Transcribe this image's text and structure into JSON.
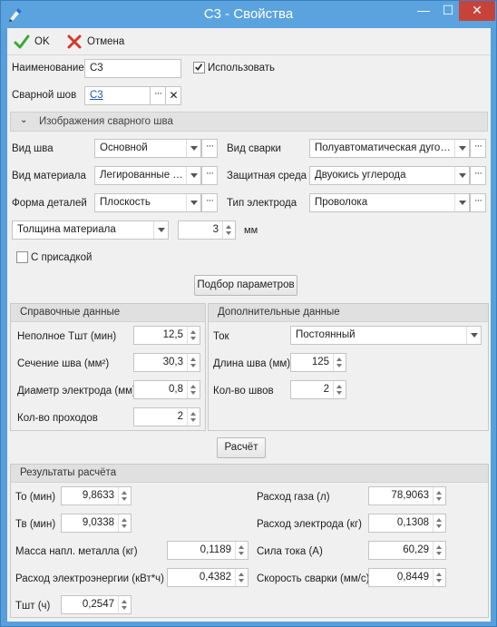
{
  "window": {
    "title": "С3 - Свойства",
    "minimize_glyph": "—",
    "maximize_glyph": "☐",
    "close_glyph": "✕"
  },
  "toolbar": {
    "ok_label": "OK",
    "cancel_label": "Отмена"
  },
  "general": {
    "name_label": "Наименование",
    "name_value": "С3",
    "use_label": "Использовать",
    "use_checked": true,
    "weld_label": "Сварной шов",
    "weld_value": "С3"
  },
  "weld_images_section": "Изображения сварного шва",
  "params": {
    "seam_type_label": "Вид шва",
    "seam_type_value": "Основной",
    "welding_type_label": "Вид сварки",
    "welding_type_value": "Полуавтоматическая дуговая",
    "material_type_label": "Вид материала",
    "material_type_value": "Легированные и...",
    "shield_env_label": "Защитная среда",
    "shield_env_value": "Двуокись углерода",
    "part_shape_label": "Форма деталей",
    "part_shape_value": "Плоскость",
    "electrode_type_label": "Тип электрода",
    "electrode_type_value": "Проволока",
    "thickness_mode_value": "Толщина материала",
    "thickness_value": "3",
    "thickness_unit": "мм",
    "filler_label": "С присадкой",
    "filler_checked": false,
    "select_params_button": "Подбор параметров"
  },
  "reference": {
    "title": "Справочные данные",
    "rows": [
      {
        "label": "Неполное Тшт (мин)",
        "value": "12,5"
      },
      {
        "label": "Сечение шва (мм²)",
        "value": "30,3"
      },
      {
        "label": "Диаметр электрода (мм)",
        "value": "0,8"
      },
      {
        "label": "Кол-во проходов",
        "value": "2"
      }
    ]
  },
  "extra": {
    "title": "Дополнительные данные",
    "current_label": "Ток",
    "current_value": "Постоянный",
    "seam_length_label": "Длина шва (мм)",
    "seam_length_value": "125",
    "seam_count_label": "Кол-во швов",
    "seam_count_value": "2"
  },
  "calc_button": "Расчёт",
  "results": {
    "title": "Результаты расчёта",
    "to_label": "То (мин)",
    "to_value": "9,8633",
    "tv_label": "Тв (мин)",
    "tv_value": "9,0338",
    "metal_mass_label": "Масса напл. металла (кг)",
    "metal_mass_value": "0,1189",
    "energy_label": "Расход электроэнергии (кВт*ч)",
    "energy_value": "0,4382",
    "tsht_label": "Тшт (ч)",
    "tsht_value": "0,2547",
    "gas_label": "Расход газа (л)",
    "gas_value": "78,9063",
    "electrode_label": "Расход электрода (кг)",
    "electrode_value": "0,1308",
    "current_label": "Сила тока (А)",
    "current_value": "60,29",
    "speed_label": "Скорость сварки (мм/с)",
    "speed_value": "0,8449"
  },
  "colors": {
    "titlebar": "#5aa3de",
    "close": "#c7433a",
    "ok_check": "#3aa935",
    "cancel_x": "#d23a2a",
    "link": "#1f56b0"
  }
}
